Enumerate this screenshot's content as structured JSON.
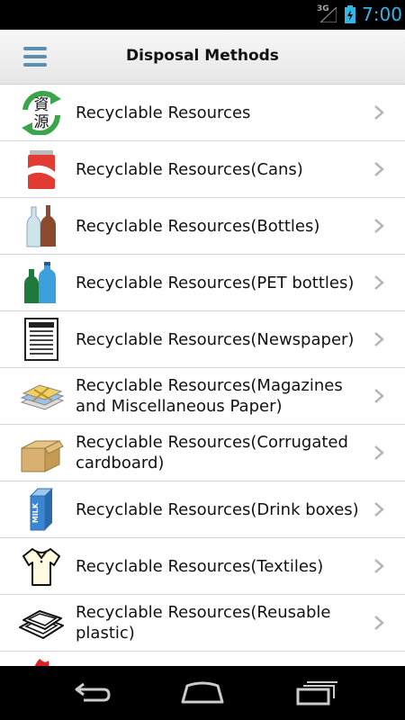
{
  "status_bar": {
    "network": "3G",
    "time": "7:00"
  },
  "app_bar": {
    "title": "Disposal Methods",
    "menu_icon": "hamburger-menu-icon"
  },
  "list": {
    "items": [
      {
        "label": "Recyclable Resources",
        "icon": "recycle-resources-icon",
        "icon_text_top": "資",
        "icon_text_bottom": "源"
      },
      {
        "label": "Recyclable Resources(Cans)",
        "icon": "can-icon"
      },
      {
        "label": "Recyclable Resources(Bottles)",
        "icon": "bottles-icon"
      },
      {
        "label": "Recyclable Resources(PET bottles)",
        "icon": "pet-bottles-icon"
      },
      {
        "label": "Recyclable Resources(Newspaper)",
        "icon": "newspaper-icon"
      },
      {
        "label": "Recyclable Resources(Magazines and Miscellaneous Paper)",
        "icon": "magazines-icon"
      },
      {
        "label": "Recyclable Resources(Corrugated cardboard)",
        "icon": "cardboard-box-icon"
      },
      {
        "label": "Recyclable Resources(Drink boxes)",
        "icon": "milk-carton-icon",
        "icon_text": "MILK"
      },
      {
        "label": "Recyclable Resources(Textiles)",
        "icon": "shirt-icon"
      },
      {
        "label": "Recyclable Resources(Reusable plastic)",
        "icon": "plastic-tray-icon"
      }
    ]
  },
  "nav_bar": {
    "back_icon": "back-icon",
    "home_icon": "home-icon",
    "recents_icon": "recent-apps-icon"
  },
  "colors": {
    "accent_time": "#33b5e5",
    "menu_icon": "#5b8fb0",
    "divider": "#d6d6d6"
  }
}
